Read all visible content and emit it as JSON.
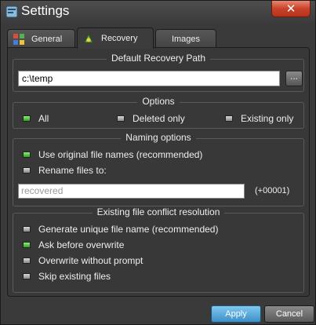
{
  "window": {
    "title": "Settings"
  },
  "tabs": [
    {
      "label": "General",
      "icon": "gear-icon"
    },
    {
      "label": "Recovery",
      "icon": "recovery-icon"
    },
    {
      "label": "Images",
      "icon": ""
    }
  ],
  "active_tab": "Recovery",
  "recovery_path": {
    "title": "Default Recovery Path",
    "value": "c:\\temp",
    "browse_label": "..."
  },
  "options": {
    "title": "Options",
    "items": [
      {
        "label": "All",
        "checked": true
      },
      {
        "label": "Deleted only",
        "checked": false
      },
      {
        "label": "Existing only",
        "checked": false
      }
    ]
  },
  "naming": {
    "title": "Naming options",
    "items": [
      {
        "label": "Use original file names (recommended)",
        "checked": true
      },
      {
        "label": "Rename files to:",
        "checked": false
      }
    ],
    "rename_placeholder": "recovered",
    "suffix": "(+00001)"
  },
  "conflict": {
    "title": "Existing file conflict resolution",
    "items": [
      {
        "label": "Generate unique file name (recommended)",
        "checked": false
      },
      {
        "label": "Ask before overwrite",
        "checked": true
      },
      {
        "label": "Overwrite without prompt",
        "checked": false
      },
      {
        "label": "Skip existing files",
        "checked": false
      }
    ]
  },
  "buttons": {
    "apply": "Apply",
    "cancel": "Cancel"
  },
  "colors": {
    "accent": "#3c8fc6",
    "checked": "#2ea01e"
  }
}
